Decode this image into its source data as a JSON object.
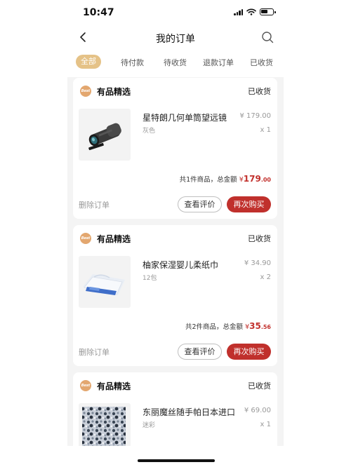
{
  "status_bar": {
    "time": "10:47"
  },
  "nav": {
    "title": "我的订单"
  },
  "tabs": [
    {
      "label": "全部",
      "active": true
    },
    {
      "label": "待付款"
    },
    {
      "label": "待收货"
    },
    {
      "label": "退款订单"
    },
    {
      "label": "已收货"
    }
  ],
  "orders": [
    {
      "shop_logo": "Best",
      "shop": "有品精选",
      "status": "已收货",
      "product": {
        "name": "星特朗几何单筒望远镜",
        "spec": "灰色",
        "price": "¥ 179.00",
        "qty": "x 1",
        "image": "monocular-telescope"
      },
      "summary": {
        "text": "共1件商品，总金额",
        "currency": "¥",
        "int": "179",
        "dec": ".00"
      },
      "actions": {
        "delete": "删除订单",
        "review": "查看评价",
        "rebuy": "再次购买"
      }
    },
    {
      "shop_logo": "Best",
      "shop": "有品精选",
      "status": "已收货",
      "product": {
        "name": "柚家保湿婴儿柔纸巾",
        "spec": "12包",
        "price": "¥ 34.90",
        "qty": "x 2",
        "image": "tissue-pack"
      },
      "summary": {
        "text": "共2件商品，总金额",
        "currency": "¥",
        "int": "35",
        "dec": ".56"
      },
      "actions": {
        "delete": "删除订单",
        "review": "查看评价",
        "rebuy": "再次购买"
      }
    },
    {
      "shop_logo": "Best",
      "shop": "有品精选",
      "status": "已收货",
      "product": {
        "name": "东丽魔丝随手帕日本进口",
        "spec": "迷彩",
        "price": "¥ 69.00",
        "qty": "x 1",
        "image": "camo-cloth"
      }
    }
  ],
  "colors": {
    "accent_gold": "#e5c287",
    "brand_red": "#c0302c",
    "bg": "#f4f4f4"
  }
}
